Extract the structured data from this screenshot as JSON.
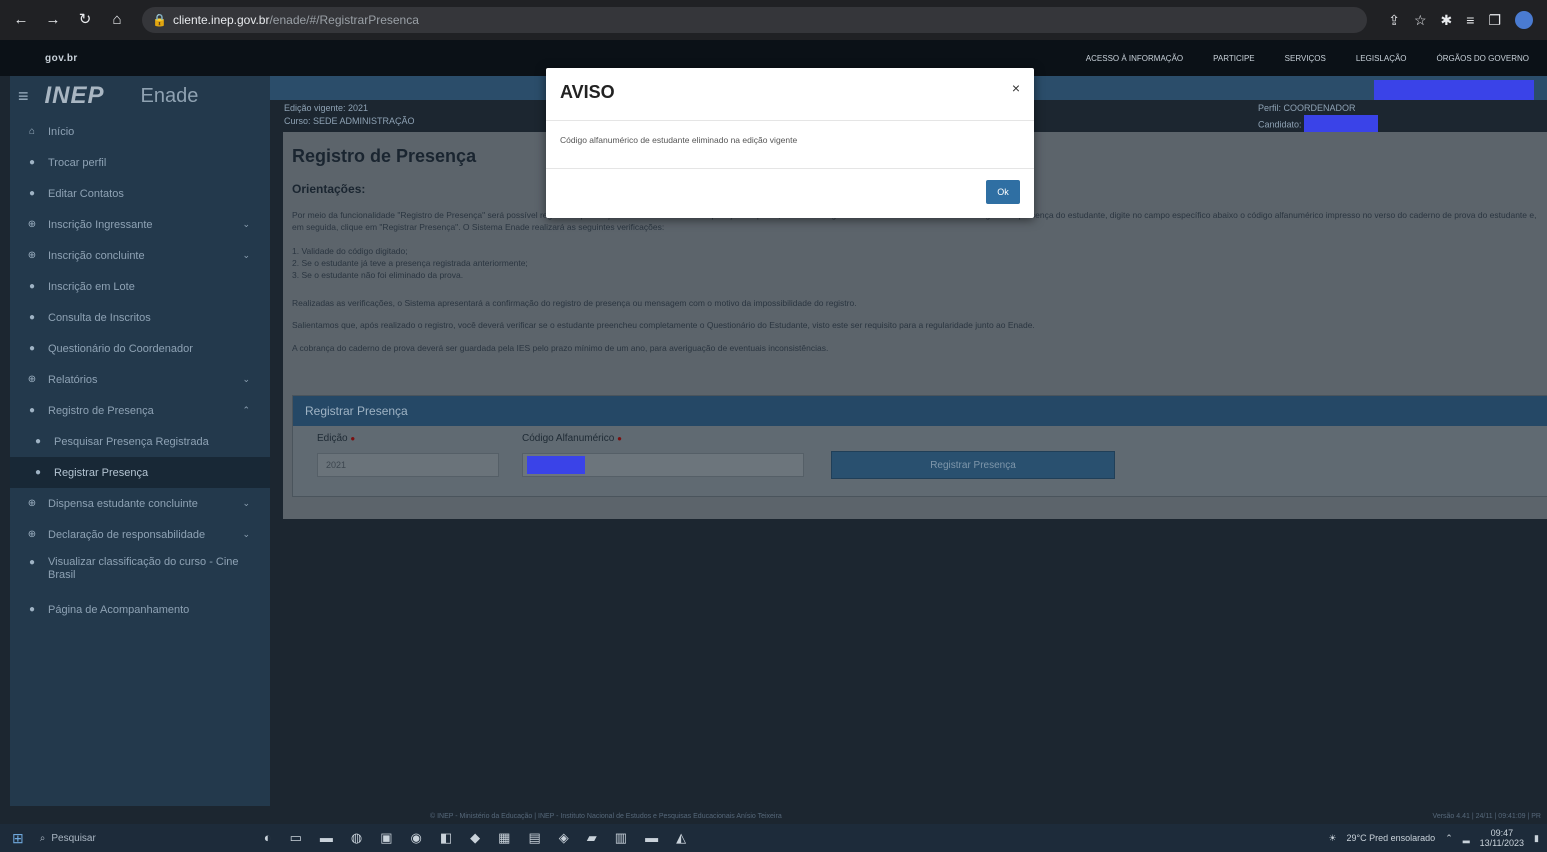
{
  "browser": {
    "url_host": "cliente.inep.gov.br",
    "url_path": "/enade/#/RegistrarPresenca"
  },
  "gov_strip": {
    "brand": "gov.br",
    "links": [
      "ACESSO À INFORMAÇÃO",
      "PARTICIPE",
      "SERVIÇOS",
      "LEGISLAÇÃO",
      "ÓRGÃOS DO GOVERNO"
    ]
  },
  "sidebar": {
    "logo": "INEP",
    "system": "Enade",
    "items": [
      {
        "label": "Início"
      },
      {
        "label": "Trocar perfil"
      },
      {
        "label": "Editar Contatos"
      },
      {
        "label": "Inscrição Ingressante"
      },
      {
        "label": "Inscrição concluinte"
      },
      {
        "label": "Inscrição em Lote"
      },
      {
        "label": "Consulta de Inscritos"
      },
      {
        "label": "Questionário do Coordenador"
      },
      {
        "label": "Relatórios"
      },
      {
        "label": "Registro de Presença"
      },
      {
        "label": "Pesquisar Presença Registrada"
      },
      {
        "label": "Registrar Presença"
      },
      {
        "label": "Dispensa estudante concluinte"
      },
      {
        "label": "Declaração de responsabilidade"
      },
      {
        "label": "Visualizar classificação do curso - Cine Brasil"
      },
      {
        "label": "Página de Acompanhamento"
      }
    ]
  },
  "info_bar": {
    "left_line1": "Edição vigente: 2021",
    "left_line2": "Curso: SEDE ADMINISTRAÇÃO",
    "right_line1": "Perfil: COORDENADOR",
    "right_line2": "Candidato:"
  },
  "main": {
    "title": "Registro de Presença",
    "orientacoes_title": "Orientações:",
    "paragraph1": "Por meio da funcionalidade \"Registro de Presença\" será possível registrar a presença do estudante no dia de aplicação da prova, conforme exigências estabelecidas em Edital. Para registrar a presença do estudante, digite no campo específico abaixo o código alfanumérico impresso no verso do caderno de prova do estudante e, em seguida, clique em \"Registrar Presença\". O Sistema Enade realizará as seguintes verificações:",
    "list": [
      "1. Validade do código digitado;",
      "2. Se o estudante já teve a presença registrada anteriormente;",
      "3. Se o estudante não foi eliminado da prova."
    ],
    "paragraph2": "Realizadas as verificações, o Sistema apresentará a confirmação do registro de presença ou mensagem com o motivo da impossibilidade do registro.",
    "paragraph3": "Salientamos que, após realizado o registro, você deverá verificar se o estudante preencheu completamente o Questionário do Estudante, visto este ser requisito para a regularidade junto ao Enade.",
    "paragraph4": "A cobrança do caderno de prova deverá ser guardada pela IES pelo prazo mínimo de um ano, para averiguação de eventuais inconsistências.",
    "register_box": {
      "header": "Registrar Presença",
      "edition_label": "Edição",
      "edition_value": "2021",
      "code_label": "Código Alfanumérico",
      "button": "Registrar Presença"
    }
  },
  "footer": {
    "center": "© INEP - Ministério da Educação | INEP - Instituto Nacional de Estudos e Pesquisas Educacionais Anísio Teixeira",
    "right": "Versão 4.41 | 24/11 | 09:41:09 | PR"
  },
  "modal": {
    "title": "AVISO",
    "message": "Código alfanumérico de estudante eliminado na edição vigente",
    "ok": "Ok"
  },
  "taskbar": {
    "search": "Pesquisar",
    "weather": "29°C Pred ensolarado",
    "time": "09:47",
    "date": "13/11/2023"
  }
}
